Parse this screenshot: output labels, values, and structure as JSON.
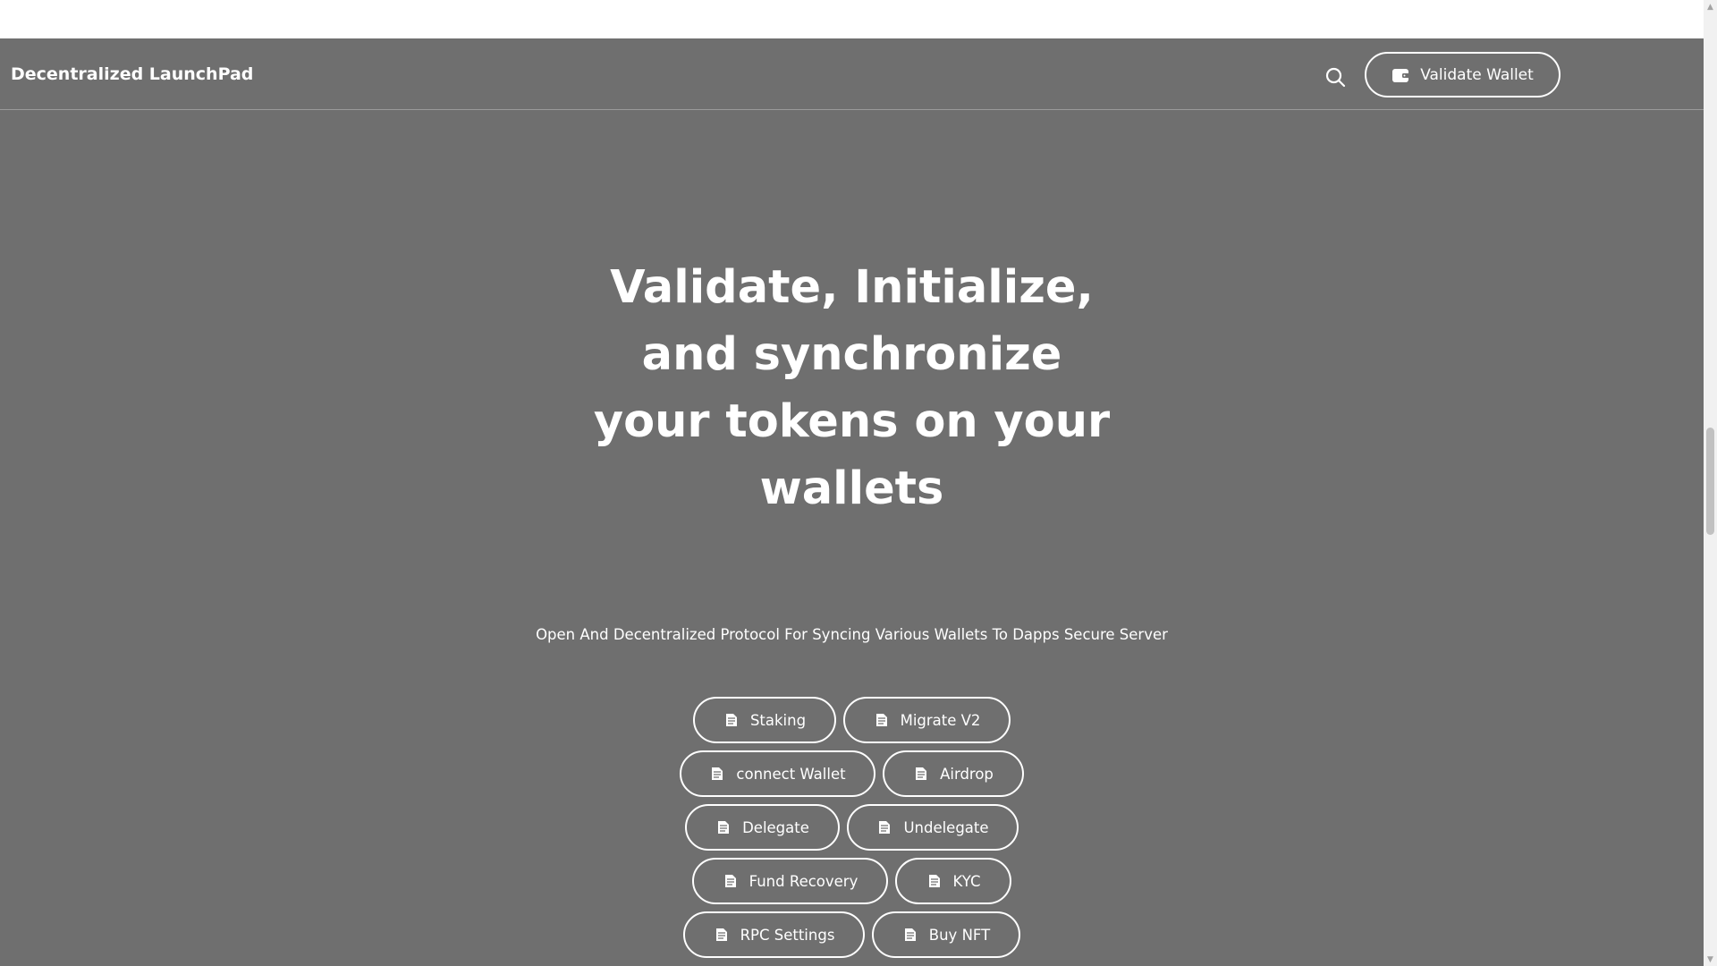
{
  "navbar": {
    "brand": "Decentralized LaunchPad",
    "search_icon": "search-icon",
    "validate_label": "Validate Wallet",
    "validate_icon": "wallet-icon"
  },
  "hero": {
    "title": "Validate, Initialize, and synchronize your tokens on your wallets",
    "subtitle": "Open And Decentralized Protocol For Syncing Various Wallets To Dapps Secure Server"
  },
  "actions": [
    {
      "label": "Staking",
      "icon": "document-icon"
    },
    {
      "label": "Migrate V2",
      "icon": "document-icon"
    },
    {
      "label": "connect Wallet",
      "icon": "document-icon"
    },
    {
      "label": "Airdrop",
      "icon": "document-icon"
    },
    {
      "label": "Delegate",
      "icon": "document-icon"
    },
    {
      "label": "Undelegate",
      "icon": "document-icon"
    },
    {
      "label": "Fund Recovery",
      "icon": "document-icon"
    },
    {
      "label": "KYC",
      "icon": "document-icon"
    },
    {
      "label": "RPC Settings",
      "icon": "document-icon"
    },
    {
      "label": "Buy NFT",
      "icon": "document-icon"
    }
  ],
  "colors": {
    "overlay": "#6f6f6f",
    "text": "#ffffff",
    "scrollbar_track": "#f1f1f1",
    "scrollbar_thumb": "#c1c1c1"
  }
}
